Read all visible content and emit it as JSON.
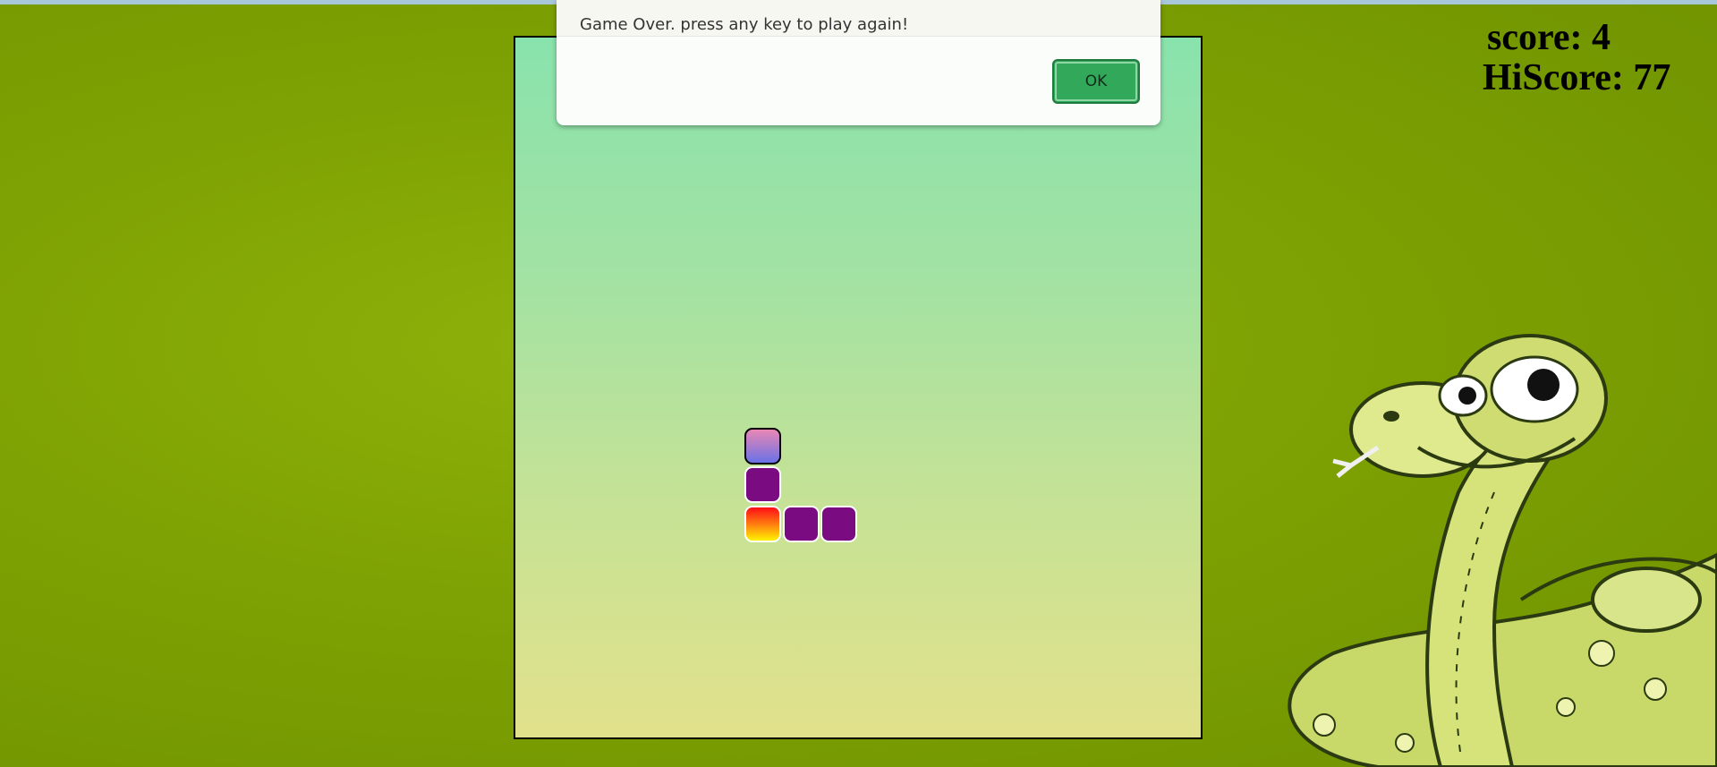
{
  "dialog": {
    "message": "Game Over. press any key to play again!",
    "ok_label": "OK"
  },
  "hud": {
    "score_text": "score: 4",
    "hiscore_text": "HiScore: 77"
  },
  "game": {
    "grid_size": 18,
    "snake": [
      {
        "col": 6,
        "row": 10,
        "role": "head"
      },
      {
        "col": 6,
        "row": 11,
        "role": "body"
      },
      {
        "col": 7,
        "row": 12,
        "role": "body"
      },
      {
        "col": 8,
        "row": 12,
        "role": "body"
      }
    ],
    "food": {
      "col": 6,
      "row": 12
    }
  },
  "colors": {
    "background": "#7fa303",
    "board_top": "#89e3ac",
    "board_bottom": "#e2e18b",
    "snake_body": "#7b0b80",
    "ok_button": "#31a85a"
  }
}
